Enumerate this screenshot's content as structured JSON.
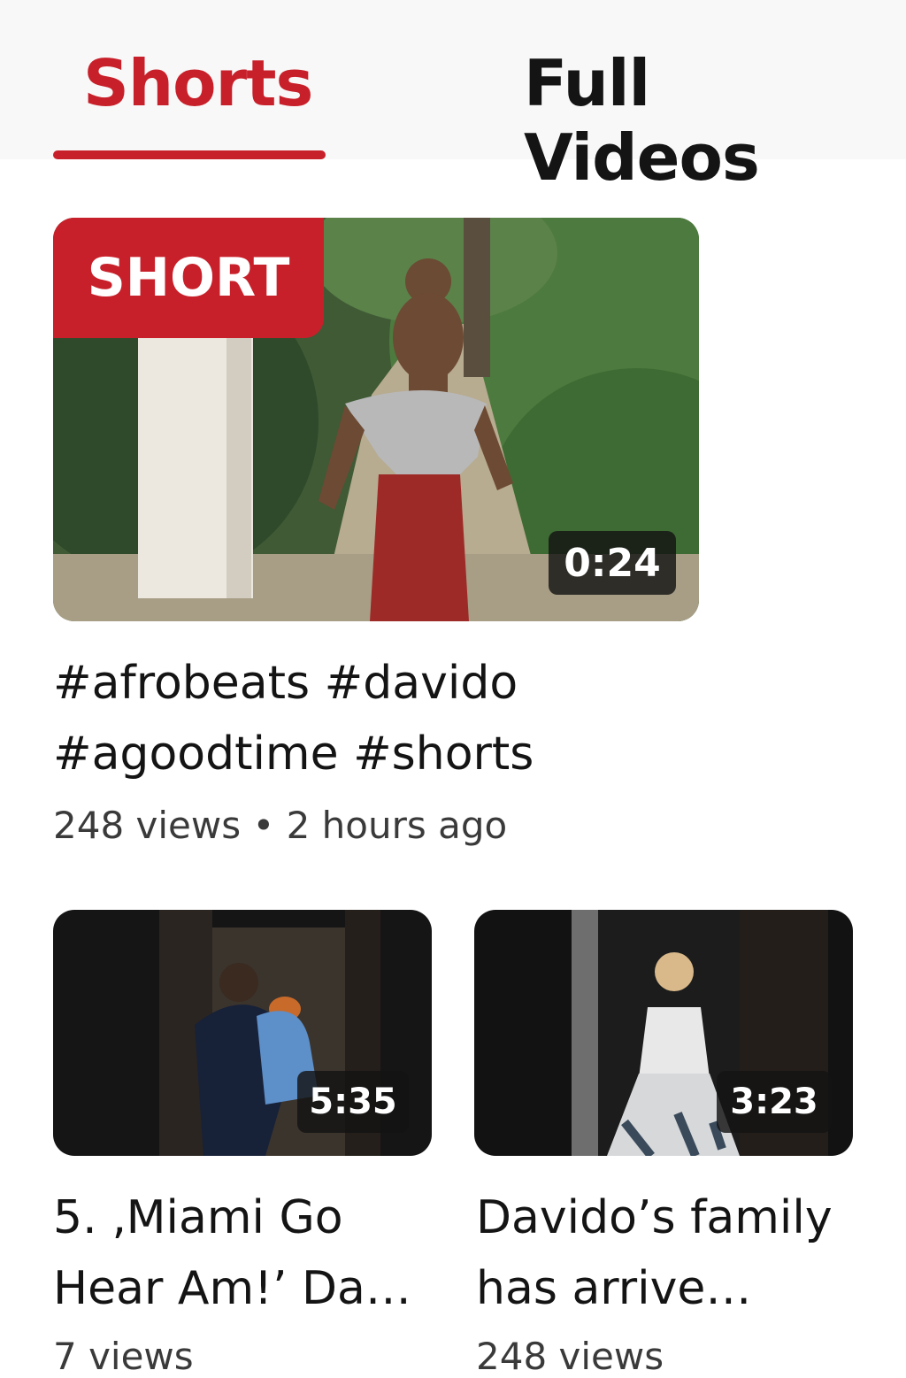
{
  "tabs": {
    "shorts_label": "Shorts",
    "full_videos_label": "Full Videos",
    "active": "shorts"
  },
  "featured": {
    "badge": "SHORT",
    "duration": "0:24",
    "title_line1": "#afrobeats #davido",
    "title_line2": "#agoodtime #shorts",
    "meta": "248 views • 2 hours ago"
  },
  "videos": [
    {
      "duration": "5:35",
      "title_line1": "5. ‚Miami Go",
      "title_line2": "Hear Am!’ Davi…",
      "meta": "7 views"
    },
    {
      "duration": "3:23",
      "title_line1": "Davido’s family",
      "title_line2": "has arrive…",
      "meta": "248 views"
    }
  ],
  "colors": {
    "accent": "#c8202a",
    "text": "#141414",
    "meta_text": "#3a3a3a",
    "tab_bar_bg": "#f8f8f8"
  }
}
